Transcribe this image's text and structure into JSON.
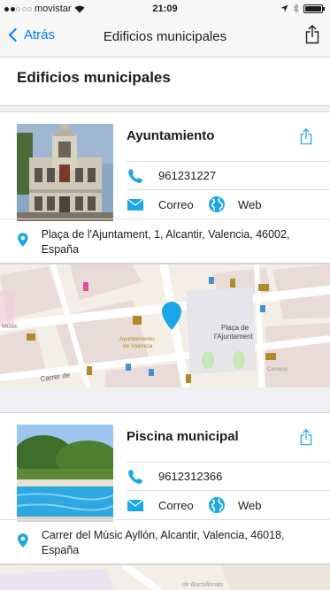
{
  "status_bar": {
    "carrier": "movistar",
    "time": "21:09"
  },
  "nav": {
    "back_label": "Atrás",
    "title": "Edificios municipales"
  },
  "section": {
    "title": "Edificios municipales"
  },
  "colors": {
    "accent": "#007aff",
    "pin": "#1aa7e8"
  },
  "items": [
    {
      "name": "Ayuntamiento",
      "phone": "961231227",
      "mail_label": "Correo",
      "web_label": "Web",
      "address": "Plaça de l'Ajuntament, 1, Alcantir, Valencia, 46002, España",
      "map_labels": {
        "plaza": "Plaça de l'Ajuntament",
        "building": "Ayuntamiento de Valencia",
        "street": "Carrer de",
        "post": "Correos",
        "side": "Músic"
      }
    },
    {
      "name": "Piscina municipal",
      "phone": "9612312366",
      "mail_label": "Correo",
      "web_label": "Web",
      "address": "Carrer del Músic Ayllón, Alcantir, Valencia, 46018, España",
      "map_labels": {
        "school": "de Bachillerato"
      }
    }
  ]
}
